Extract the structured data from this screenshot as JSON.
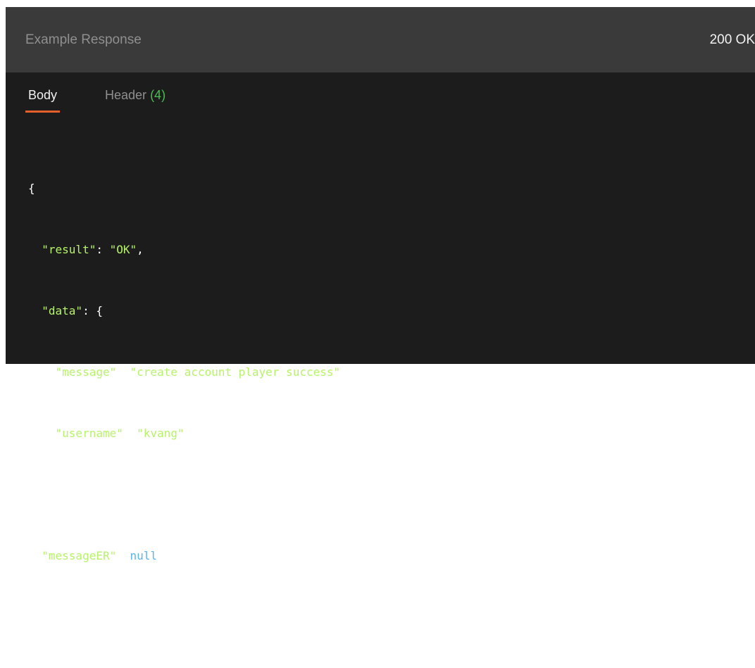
{
  "header": {
    "title": "Example Response",
    "status": "200 OK"
  },
  "tabs": {
    "body_label": "Body",
    "header_label": "Header",
    "header_count": "(4)"
  },
  "response": {
    "open_brace": "{",
    "result_key": "\"result\"",
    "result_value": "\"OK\"",
    "data_key": "\"data\"",
    "data_open": "{",
    "message_key": "\"message\"",
    "message_value": "\"create account player success\"",
    "username_key": "\"username\"",
    "username_value": "\"kvang\"",
    "data_close": "},",
    "messageER_key": "\"messageER\"",
    "messageER_value": "null",
    "close_brace": "}"
  },
  "colors": {
    "header_bg": "#3a3a3a",
    "panel_bg": "#1c1c1c",
    "tab_underline": "#e4602a",
    "count_green": "#4bbf4f",
    "json_string": "#b7f36a",
    "json_null": "#59b4f0"
  }
}
